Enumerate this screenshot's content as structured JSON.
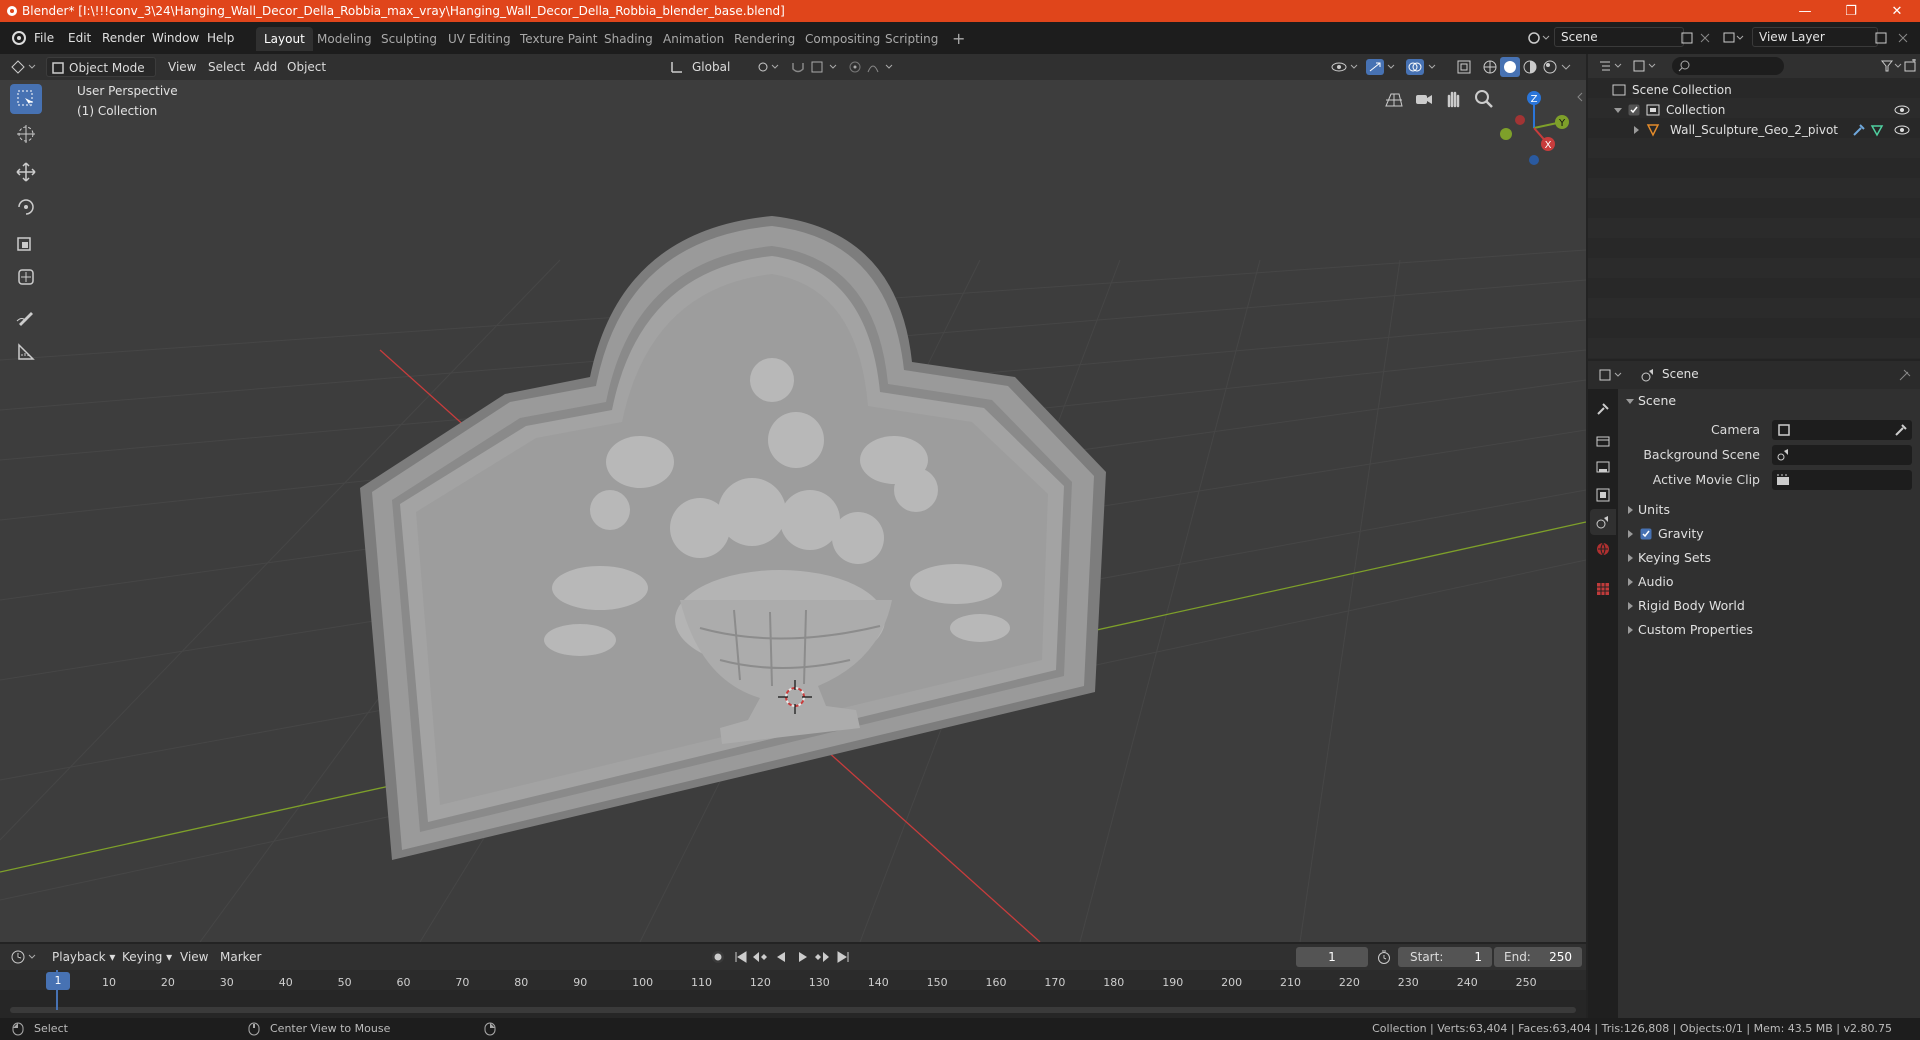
{
  "window": {
    "title": "Blender* [I:\\!!!conv_3\\24\\Hanging_Wall_Decor_Della_Robbia_max_vray\\Hanging_Wall_Decor_Della_Robbia_blender_base.blend]"
  },
  "menus": [
    "File",
    "Edit",
    "Render",
    "Window",
    "Help"
  ],
  "workspaces": [
    "Layout",
    "Modeling",
    "Sculpting",
    "UV Editing",
    "Texture Paint",
    "Shading",
    "Animation",
    "Rendering",
    "Compositing",
    "Scripting"
  ],
  "active_workspace": "Layout",
  "scene_field": "Scene",
  "viewlayer_field": "View Layer",
  "viewport_header": {
    "mode": "Object Mode",
    "menus": [
      "View",
      "Select",
      "Add",
      "Object"
    ],
    "orientation": "Global"
  },
  "viewport": {
    "perspective_label": "User Perspective",
    "collection_label": "(1) Collection",
    "gizmo": {
      "z": "Z",
      "y": "Y",
      "x": "X"
    }
  },
  "outliner": {
    "root": "Scene Collection",
    "collection": "Collection",
    "object": "Wall_Sculpture_Geo_2_pivot"
  },
  "properties": {
    "header": "Scene",
    "panel": "Scene",
    "camera_label": "Camera",
    "background_label": "Background Scene",
    "movieclip_label": "Active Movie Clip",
    "sections": [
      "Units",
      "Gravity",
      "Keying Sets",
      "Audio",
      "Rigid Body World",
      "Custom Properties"
    ],
    "gravity_checked": true
  },
  "timeline": {
    "menus": [
      "Playback",
      "Keying",
      "View",
      "Marker"
    ],
    "current_frame": "1",
    "start_label": "Start:",
    "start": "1",
    "end_label": "End:",
    "end": "250",
    "ticks": [
      "1",
      "10",
      "20",
      "30",
      "40",
      "50",
      "60",
      "70",
      "80",
      "90",
      "100",
      "110",
      "120",
      "130",
      "140",
      "150",
      "160",
      "170",
      "180",
      "190",
      "200",
      "210",
      "220",
      "230",
      "240",
      "250"
    ]
  },
  "status": {
    "select": "Select",
    "center": "Center View to Mouse",
    "stats": "Collection | Verts:63,404 | Faces:63,404 | Tris:126,808 | Objects:0/1 | Mem: 43.5 MB | v2.80.75"
  },
  "colors": {
    "accent": "#4772b3",
    "titlebar": "#e0451b",
    "x_axis": "#c83c3c",
    "y_axis": "#7ea02a",
    "z_axis": "#2a75d9"
  }
}
